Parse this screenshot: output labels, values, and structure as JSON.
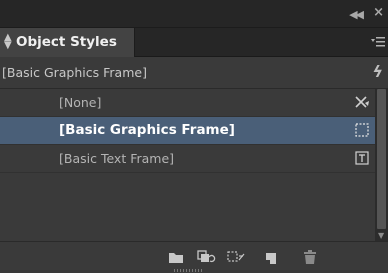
{
  "panel": {
    "collapse_icon": "double-chevron-left-icon",
    "close_icon": "close-icon",
    "tab_title": "Object Styles",
    "tab_sort_icon": "sort-arrows-icon",
    "panel_menu_icon": "panel-menu-icon"
  },
  "current_style": {
    "label": "[Basic Graphics Frame]",
    "icon": "lightning-bolt-icon"
  },
  "styles": [
    {
      "label": "[None]",
      "icon": "none-style-icon",
      "selected": false
    },
    {
      "label": "[Basic Graphics Frame]",
      "icon": "graphics-frame-icon",
      "selected": true
    },
    {
      "label": "[Basic Text Frame]",
      "icon": "text-frame-icon",
      "selected": false
    }
  ],
  "bottom_toolbar": [
    {
      "name": "new-group-button",
      "icon": "folder-icon"
    },
    {
      "name": "clear-overrides-button",
      "icon": "clear-overrides-icon"
    },
    {
      "name": "clear-non-defined-button",
      "icon": "clear-attributes-icon"
    },
    {
      "name": "new-style-button",
      "icon": "new-style-icon"
    },
    {
      "name": "delete-style-button",
      "icon": "trash-icon"
    }
  ],
  "colors": {
    "panel_bg": "#3a3a3a",
    "selection": "#4a5f78",
    "tab_bg": "#434343"
  }
}
